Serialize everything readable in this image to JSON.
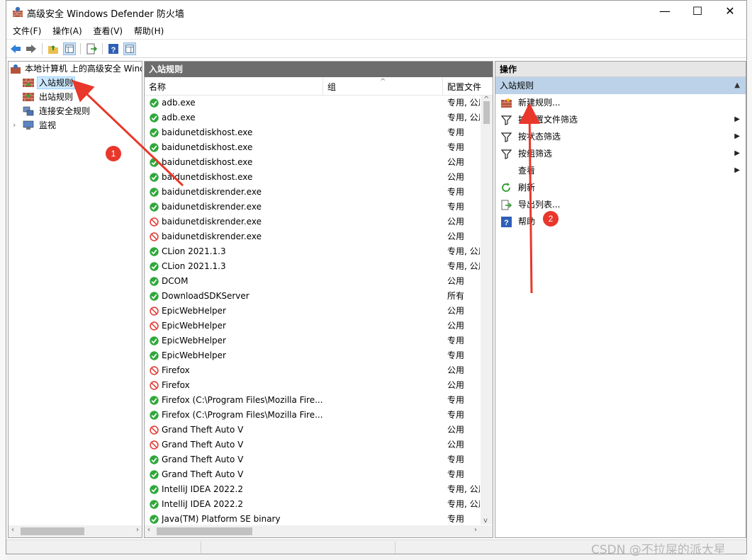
{
  "window": {
    "title": "高级安全 Windows Defender 防火墙",
    "minimize_glyph": "—",
    "maximize_glyph": "☐",
    "close_glyph": "✕"
  },
  "menu": [
    "文件(F)",
    "操作(A)",
    "查看(V)",
    "帮助(H)"
  ],
  "tree": {
    "root": "本地计算机 上的高级安全 Windows Defender 防火墙",
    "items": [
      {
        "label": "入站规则",
        "icon": "inbound-rules-icon",
        "selected": true
      },
      {
        "label": "出站规则",
        "icon": "outbound-rules-icon",
        "selected": false
      },
      {
        "label": "连接安全规则",
        "icon": "connection-security-icon",
        "selected": false
      },
      {
        "label": "监视",
        "icon": "monitor-icon",
        "selected": false
      }
    ]
  },
  "rules_pane": {
    "header": "入站规则",
    "columns": {
      "name": "名称",
      "group": "组",
      "profile": "配置文件"
    },
    "rows": [
      {
        "name": "adb.exe",
        "status": "allow",
        "group": "",
        "profile": "专用, 公用"
      },
      {
        "name": "adb.exe",
        "status": "allow",
        "group": "",
        "profile": "专用, 公用"
      },
      {
        "name": "baidunetdiskhost.exe",
        "status": "allow",
        "group": "",
        "profile": "专用"
      },
      {
        "name": "baidunetdiskhost.exe",
        "status": "allow",
        "group": "",
        "profile": "专用"
      },
      {
        "name": "baidunetdiskhost.exe",
        "status": "allow",
        "group": "",
        "profile": "公用"
      },
      {
        "name": "baidunetdiskhost.exe",
        "status": "allow",
        "group": "",
        "profile": "公用"
      },
      {
        "name": "baidunetdiskrender.exe",
        "status": "allow",
        "group": "",
        "profile": "专用"
      },
      {
        "name": "baidunetdiskrender.exe",
        "status": "allow",
        "group": "",
        "profile": "专用"
      },
      {
        "name": "baidunetdiskrender.exe",
        "status": "block",
        "group": "",
        "profile": "公用"
      },
      {
        "name": "baidunetdiskrender.exe",
        "status": "block",
        "group": "",
        "profile": "公用"
      },
      {
        "name": "CLion 2021.1.3",
        "status": "allow",
        "group": "",
        "profile": "专用, 公用"
      },
      {
        "name": "CLion 2021.1.3",
        "status": "allow",
        "group": "",
        "profile": "专用, 公用"
      },
      {
        "name": "DCOM",
        "status": "allow",
        "group": "",
        "profile": "公用"
      },
      {
        "name": "DownloadSDKServer",
        "status": "allow",
        "group": "",
        "profile": "所有"
      },
      {
        "name": "EpicWebHelper",
        "status": "block",
        "group": "",
        "profile": "公用"
      },
      {
        "name": "EpicWebHelper",
        "status": "block",
        "group": "",
        "profile": "公用"
      },
      {
        "name": "EpicWebHelper",
        "status": "allow",
        "group": "",
        "profile": "专用"
      },
      {
        "name": "EpicWebHelper",
        "status": "allow",
        "group": "",
        "profile": "专用"
      },
      {
        "name": "Firefox",
        "status": "block",
        "group": "",
        "profile": "公用"
      },
      {
        "name": "Firefox",
        "status": "block",
        "group": "",
        "profile": "公用"
      },
      {
        "name": "Firefox (C:\\Program Files\\Mozilla Fire...",
        "status": "allow",
        "group": "",
        "profile": "专用"
      },
      {
        "name": "Firefox (C:\\Program Files\\Mozilla Fire...",
        "status": "allow",
        "group": "",
        "profile": "专用"
      },
      {
        "name": "Grand Theft Auto V",
        "status": "block",
        "group": "",
        "profile": "公用"
      },
      {
        "name": "Grand Theft Auto V",
        "status": "block",
        "group": "",
        "profile": "公用"
      },
      {
        "name": "Grand Theft Auto V",
        "status": "allow",
        "group": "",
        "profile": "专用"
      },
      {
        "name": "Grand Theft Auto V",
        "status": "allow",
        "group": "",
        "profile": "专用"
      },
      {
        "name": "IntelliJ IDEA 2022.2",
        "status": "allow",
        "group": "",
        "profile": "专用, 公用"
      },
      {
        "name": "IntelliJ IDEA 2022.2",
        "status": "allow",
        "group": "",
        "profile": "专用, 公用"
      },
      {
        "name": "Java(TM) Platform SE binary",
        "status": "allow",
        "group": "",
        "profile": "专用"
      }
    ]
  },
  "actions_pane": {
    "title": "操作",
    "section": "入站规则",
    "items": [
      {
        "label": "新建规则...",
        "icon": "new-rule-icon",
        "submenu": false
      },
      {
        "label": "按配置文件筛选",
        "icon": "filter-icon",
        "submenu": true
      },
      {
        "label": "按状态筛选",
        "icon": "filter-icon",
        "submenu": true
      },
      {
        "label": "按组筛选",
        "icon": "filter-icon",
        "submenu": true
      },
      {
        "label": "查看",
        "icon": "",
        "submenu": true
      },
      {
        "label": "刷新",
        "icon": "refresh-icon",
        "submenu": false
      },
      {
        "label": "导出列表...",
        "icon": "export-icon",
        "submenu": false
      },
      {
        "label": "帮助",
        "icon": "help-icon",
        "submenu": false
      }
    ]
  },
  "annotations": {
    "badge1": "1",
    "badge2": "2"
  },
  "watermark": "CSDN @不拉屎的派大星",
  "colors": {
    "allow": "#2fa83a",
    "block": "#e0403a",
    "arrow": "#e9372b",
    "selection": "#cce8ff",
    "pane_header": "#6d6d6d",
    "section": "#bcd2e8"
  }
}
